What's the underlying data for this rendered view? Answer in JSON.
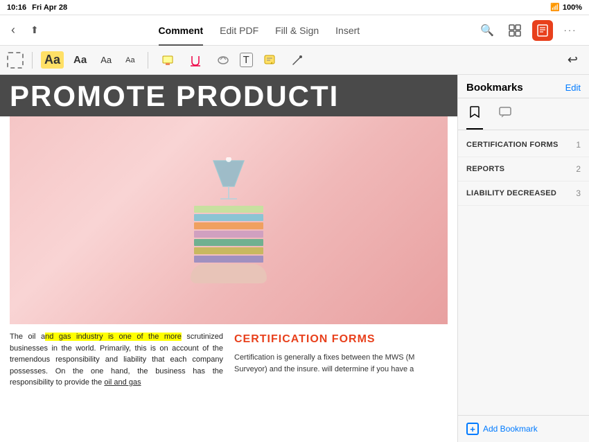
{
  "statusBar": {
    "time": "10:16",
    "day": "Fri Apr 28",
    "wifi": "WiFi",
    "battery": "100%"
  },
  "topToolbar": {
    "backLabel": "‹",
    "shareLabel": "⬆",
    "tabs": [
      {
        "id": "comment",
        "label": "Comment",
        "active": true
      },
      {
        "id": "editpdf",
        "label": "Edit PDF",
        "active": false
      },
      {
        "id": "fillandsign",
        "label": "Fill & Sign",
        "active": false
      },
      {
        "id": "insert",
        "label": "Insert",
        "active": false
      }
    ],
    "moreDots": "···",
    "searchIcon": "🔍",
    "gridIcon": "⊞",
    "bookmarkActiveIcon": "⊟",
    "moreIcon": "···"
  },
  "annotationToolbar": {
    "buttons": [
      {
        "id": "text-aa-big",
        "label": "Aa",
        "style": "big"
      },
      {
        "id": "text-aa-med",
        "label": "Aa",
        "style": "medium"
      },
      {
        "id": "text-aa-small",
        "label": "Aa",
        "style": "small"
      },
      {
        "id": "text-aa-tiny",
        "label": "Aa",
        "style": "tiny"
      },
      {
        "id": "highlight",
        "label": "✏"
      },
      {
        "id": "underline",
        "label": "✒"
      },
      {
        "id": "strikethrough",
        "label": "✖"
      },
      {
        "id": "text-box",
        "label": "T"
      },
      {
        "id": "sticky-note",
        "label": "🗒"
      },
      {
        "id": "draw",
        "label": "✍"
      }
    ],
    "undoLabel": "↩"
  },
  "pdf": {
    "heading": "PROMOTE PRODUCTI",
    "bodyLeft": "The oil and gas industry is one of the more scrutinized businesses in the world. Primarily, this is on account of the tremendous responsibility and liability that each company possesses. On the one hand, the business has the responsibility to provide the oil and gas",
    "highlightedText": "nd gas industry is one of the more",
    "rightHeading": "CERTIFICATION FORMS",
    "bodyRight": "Certification is generally a fixes between the MWS (M Surveyor) and the insure. will determine if you have a"
  },
  "sidebar": {
    "title": "Bookmarks",
    "editLabel": "Edit",
    "tabs": [
      {
        "id": "bookmark-tab",
        "icon": "⊟",
        "active": true
      },
      {
        "id": "comment-tab",
        "icon": "💬",
        "active": false
      }
    ],
    "items": [
      {
        "id": "cert-forms",
        "label": "CERTIFICATION FORMS",
        "number": "1"
      },
      {
        "id": "reports",
        "label": "REPORTS",
        "number": "2"
      },
      {
        "id": "liability",
        "label": "LIABILITY DECREASED",
        "number": "3"
      }
    ],
    "addBookmarkLabel": "Add Bookmark"
  }
}
